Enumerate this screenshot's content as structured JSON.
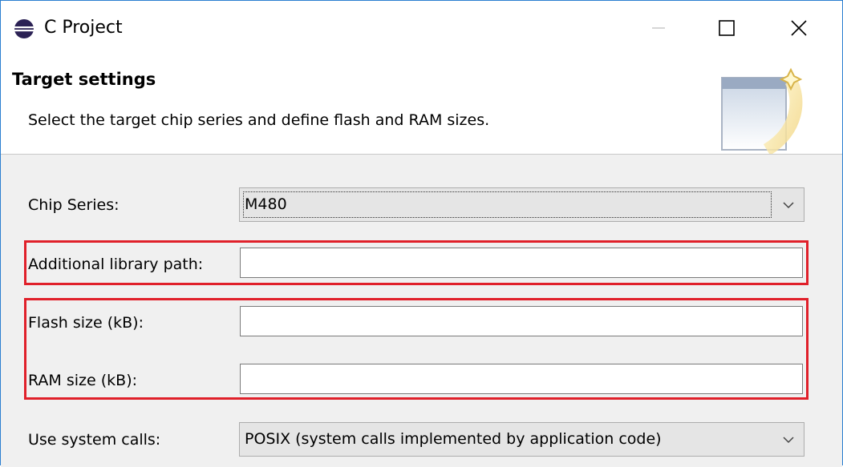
{
  "window": {
    "title": "C Project",
    "accent": "#2b7fd0"
  },
  "titlebar": {
    "app_icon": "eclipse-icon",
    "minimize_icon": "minimize-icon",
    "maximize_icon": "maximize-icon",
    "close_icon": "close-icon"
  },
  "header": {
    "title": "Target settings",
    "description": "Select the target chip series and define flash and RAM sizes.",
    "wizard_icon": "wizard-banner-icon"
  },
  "form": {
    "chip_series": {
      "label": "Chip Series:",
      "value": "M480"
    },
    "library_path": {
      "label": "Additional library path:",
      "value": ""
    },
    "flash_size": {
      "label": "Flash size (kB):",
      "value": ""
    },
    "ram_size": {
      "label": "RAM size (kB):",
      "value": ""
    },
    "system_calls": {
      "label": "Use system calls:",
      "value": "POSIX (system calls implemented by application code)"
    }
  },
  "highlight_color": "#e0202a"
}
